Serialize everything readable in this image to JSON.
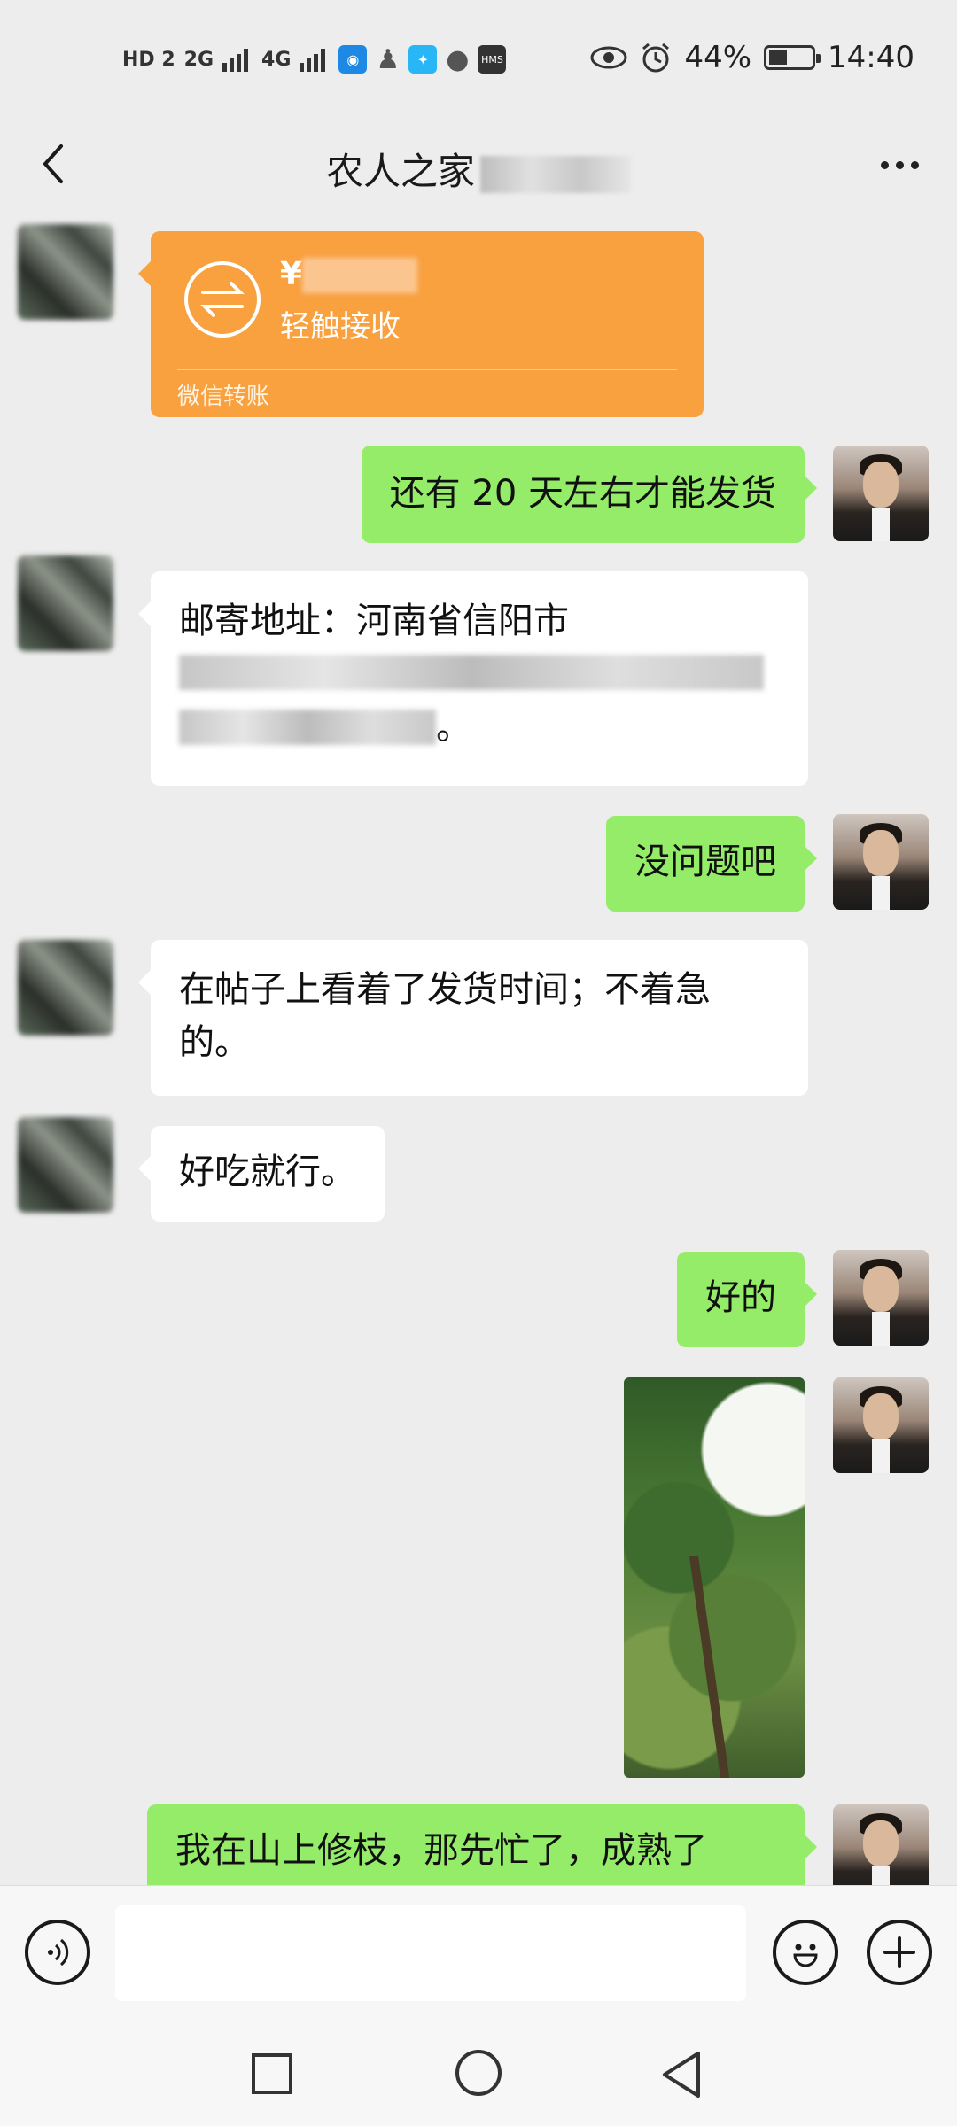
{
  "status_bar": {
    "left_icons": [
      "HD 2",
      "2G",
      "4G",
      "eye-app",
      "qq",
      "bulb",
      "chat",
      "HMS"
    ],
    "network_1": "2G",
    "network_2": "4G",
    "battery_percent": "44%",
    "battery_level": 0.44,
    "time": "14:40"
  },
  "header": {
    "title": "农人之家",
    "back_icon": "chevron-left-icon",
    "more_icon": "more-dots-icon"
  },
  "messages": [
    {
      "side": "other",
      "type": "transfer",
      "amount_prefix": "¥",
      "action": "轻触接收",
      "footer": "微信转账"
    },
    {
      "side": "me",
      "type": "text",
      "text": "还有 20 天左右才能发货"
    },
    {
      "side": "other",
      "type": "text",
      "text": "邮寄地址：河南省信阳市",
      "tail": "。"
    },
    {
      "side": "me",
      "type": "text",
      "text": "没问题吧"
    },
    {
      "side": "other",
      "type": "text",
      "text": "在帖子上看着了发货时间；不着急的。"
    },
    {
      "side": "other",
      "type": "text",
      "text": "好吃就行。"
    },
    {
      "side": "me",
      "type": "text",
      "text": "好的"
    },
    {
      "side": "me",
      "type": "image",
      "alt": "tree photo"
    },
    {
      "side": "me",
      "type": "text",
      "text": "我在山上修枝，那先忙了，成熟了"
    }
  ],
  "input_bar": {
    "voice_icon": "voice-icon",
    "emoji_icon": "emoji-icon",
    "plus_icon": "plus-icon",
    "placeholder": ""
  },
  "nav_bar": {
    "recent_icon": "square-icon",
    "home_icon": "circle-icon",
    "back_icon": "triangle-back-icon"
  },
  "colors": {
    "background": "#ededed",
    "green_bubble": "#95ec69",
    "white_bubble": "#ffffff",
    "transfer_orange": "#f9a03f"
  }
}
